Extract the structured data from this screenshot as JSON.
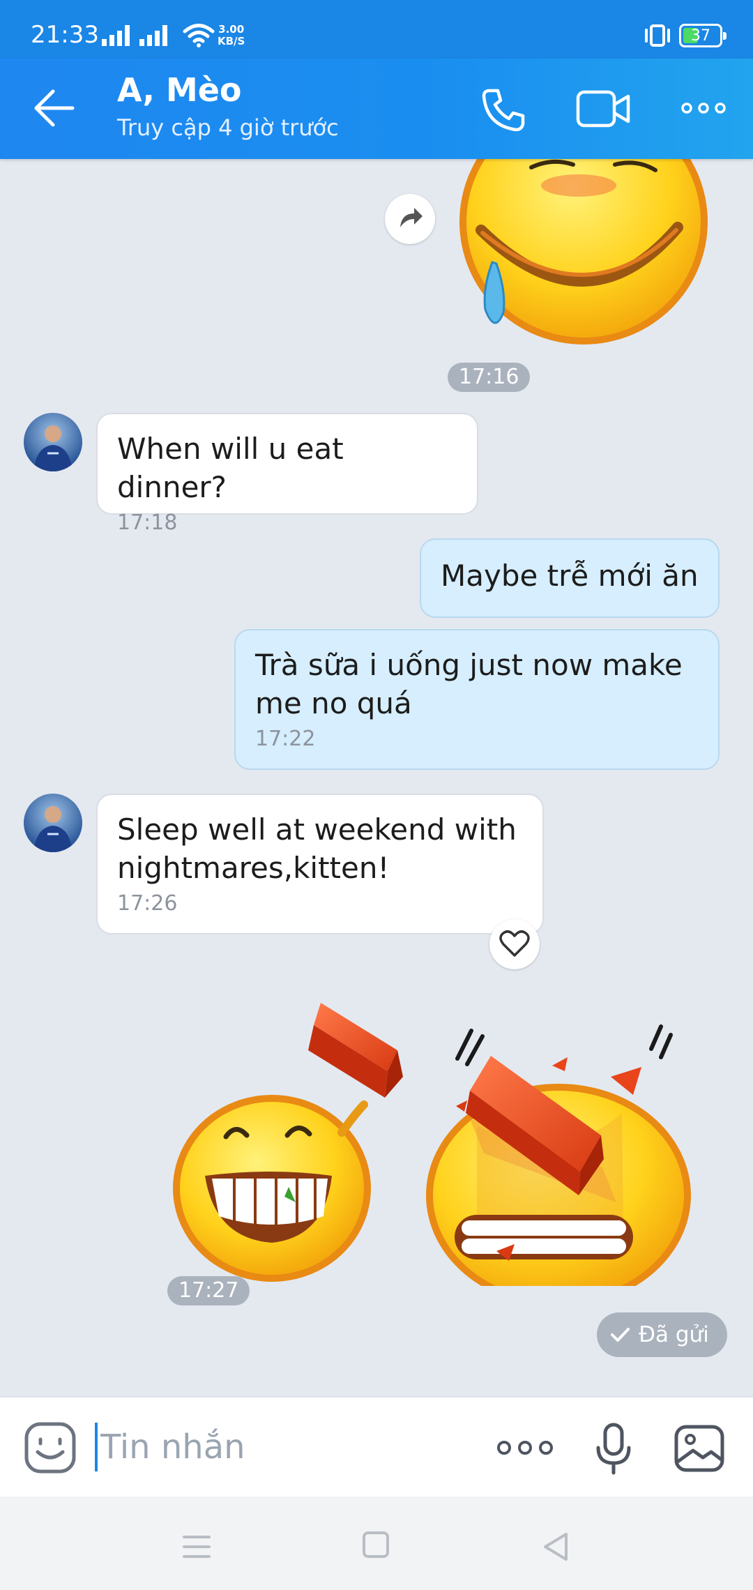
{
  "status_bar": {
    "time": "21:33",
    "net_speed_value": "3.00",
    "net_speed_unit": "KB/S",
    "battery": "37"
  },
  "header": {
    "title": "A, Mèo",
    "subtitle": "Truy cập 4 giờ trước",
    "icons": [
      "back-arrow-icon",
      "phone-icon",
      "video-camera-icon",
      "more-icon"
    ]
  },
  "messages": [
    {
      "type": "sticker",
      "direction": "out",
      "sticker": "drooling-smiley",
      "time": "17:16"
    },
    {
      "type": "text",
      "direction": "in",
      "text": "When will u eat dinner?",
      "time": "17:18"
    },
    {
      "type": "text",
      "direction": "out",
      "text": "Maybe trễ mới ăn",
      "time": ""
    },
    {
      "type": "text",
      "direction": "out",
      "text": "Trà sữa i uống just now make me no quá",
      "time": "17:22"
    },
    {
      "type": "text",
      "direction": "in",
      "text": "Sleep well at weekend with nightmares,kitten!",
      "time": "17:26"
    },
    {
      "type": "sticker",
      "direction": "out",
      "sticker": "brick-hit-smiley",
      "time": "17:27"
    }
  ],
  "sent_status": "Đã gửi",
  "input": {
    "placeholder": "Tin nhắn",
    "value": ""
  },
  "colors": {
    "header": "#1a86e6",
    "chat_background": "#e4e9f0",
    "outgoing_bubble": "#d6eefd",
    "incoming_bubble": "#ffffff",
    "time_pill": "#aab2bd"
  }
}
